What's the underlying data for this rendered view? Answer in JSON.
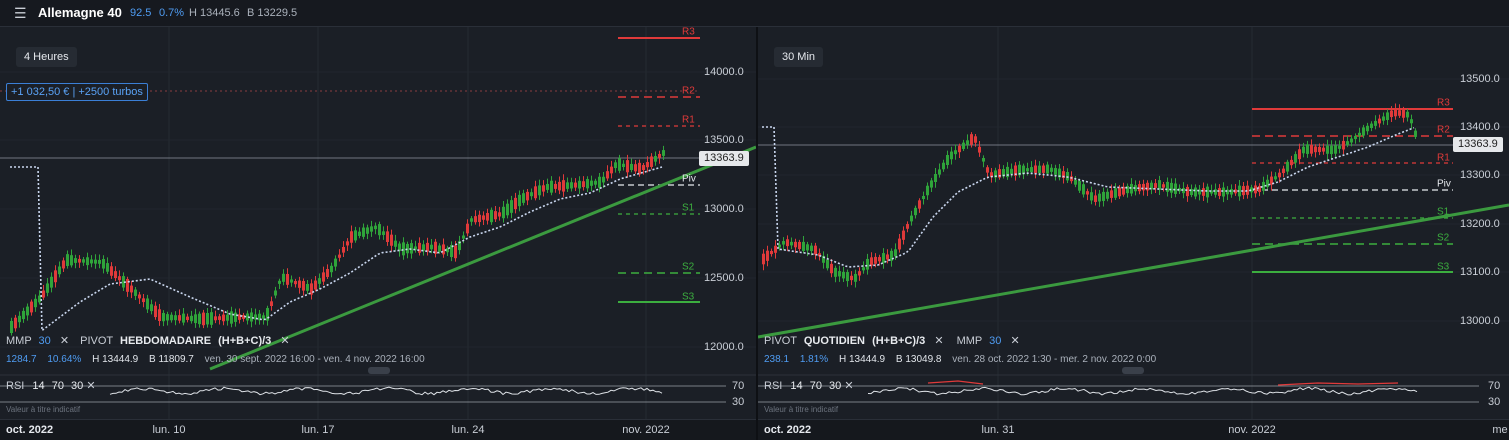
{
  "header": {
    "menu_icon": "hamburger-icon",
    "symbol": "Allemagne 40",
    "change_points": "92.5",
    "change_percent": "0.7%",
    "high": "H 13445.6",
    "low": "B 13229.5"
  },
  "left": {
    "timeframe": "4 Heures",
    "turbo_text": "+1 032,50 € | +2500 turbos",
    "price_tag": "13363.9",
    "yaxis": [
      "14000.0",
      "13500.0",
      "13000.0",
      "12500.0",
      "12000.0"
    ],
    "levels": [
      "R3",
      "R2",
      "R1",
      "Piv",
      "S1",
      "S2",
      "S3"
    ],
    "legend": {
      "mmp": "MMP",
      "mmp_period": "30",
      "pivot": "PIVOT",
      "pivot_type": "HEBDOMADAIRE",
      "formula": "(H+B+C)/3"
    },
    "stats": {
      "points": "1284.7",
      "percent": "10.64%",
      "high": "H 13444.9",
      "low": "B 11809.7",
      "range": "ven. 30 sept. 2022 16:00 - ven. 4 nov. 2022 16:00"
    },
    "rsi": {
      "label": "RSI",
      "p1": "14",
      "p2": "70",
      "p3": "30",
      "levels": [
        "70",
        "30"
      ]
    },
    "indicative": "Valeur à titre indicatif",
    "xaxis": [
      "oct. 2022",
      "lun. 10",
      "lun. 17",
      "lun. 24",
      "nov. 2022"
    ]
  },
  "right": {
    "timeframe": "30 Min",
    "price_tag": "13363.9",
    "yaxis": [
      "13500.0",
      "13400.0",
      "13300.0",
      "13200.0",
      "13100.0",
      "13000.0"
    ],
    "levels": [
      "R3",
      "R2",
      "R1",
      "Piv",
      "S1",
      "S2",
      "S3"
    ],
    "legend": {
      "pivot": "PIVOT",
      "pivot_type": "QUOTIDIEN",
      "formula": "(H+B+C)/3",
      "mmp": "MMP",
      "mmp_period": "30"
    },
    "stats": {
      "points": "238.1",
      "percent": "1.81%",
      "high": "H 13444.9",
      "low": "B 13049.8",
      "range": "ven. 28 oct. 2022 1:30 - mer. 2 nov. 2022 0:00"
    },
    "rsi": {
      "label": "RSI",
      "p1": "14",
      "p2": "70",
      "p3": "30",
      "levels": [
        "70",
        "30"
      ]
    },
    "indicative": "Valeur à titre indicatif",
    "xaxis": [
      "oct. 2022",
      "lun. 31",
      "nov. 2022",
      "me"
    ]
  },
  "colors": {
    "up": "#2fa43a",
    "down": "#e03a3a",
    "trendline": "#3b9a3f",
    "mmp": "#c9d6ee",
    "resistance": "#e03a3a",
    "support": "#3cae3f",
    "accent": "#4f9cf2"
  }
}
